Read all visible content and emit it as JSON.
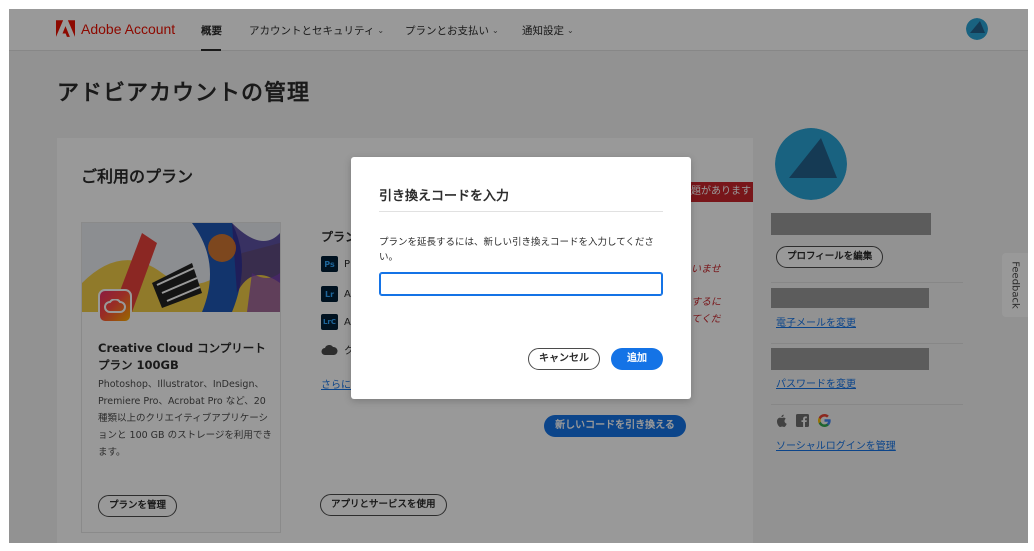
{
  "nav": {
    "brand": "Adobe Account",
    "items": [
      {
        "label": "概要",
        "active": true
      },
      {
        "label": "アカウントとセキュリティ"
      },
      {
        "label": "プランとお支払い"
      },
      {
        "label": "通知設定"
      }
    ]
  },
  "page": {
    "title": "アドビアカウントの管理"
  },
  "plan": {
    "heading": "ご利用のプラン",
    "alert": "題があります",
    "card": {
      "name": "Creative Cloud コンプリートプラン 100GB",
      "description": "Photoshop、Illustrator、InDesign、Premiere Pro、Acrobat Pro など、20 種類以上のクリエイティブアプリケーションと 100 GB のストレージを利用できます。",
      "manage_button": "プランを管理"
    },
    "apps": {
      "title": "プラン",
      "items": [
        {
          "badge": "Ps",
          "label": "P"
        },
        {
          "badge": "Lr",
          "label": "A"
        },
        {
          "badge": "LrC",
          "label": "A"
        },
        {
          "badge": "cloud-icon",
          "label": "ク"
        }
      ],
      "see_more": "さらに",
      "use_button": "アプリとサービスを使用"
    },
    "warnings": [
      "いませ",
      "するに",
      "てくだ"
    ],
    "redeem_button": "新しいコードを引き換える"
  },
  "profile": {
    "edit_button": "プロフィールを編集",
    "change_email": "電子メールを変更",
    "change_password": "パスワードを変更",
    "social_manage": "ソーシャルログインを管理",
    "social_icons": [
      "apple-icon",
      "facebook-icon",
      "google-icon"
    ]
  },
  "feedback": "Feedback",
  "dialog": {
    "title": "引き換えコードを入力",
    "body": "プランを延長するには、新しい引き換えコードを入力してください。",
    "input_value": "",
    "cancel": "キャンセル",
    "add": "追加"
  },
  "colors": {
    "accent": "#1473e6",
    "alert": "#c9252c",
    "brand": "#eb1000"
  }
}
